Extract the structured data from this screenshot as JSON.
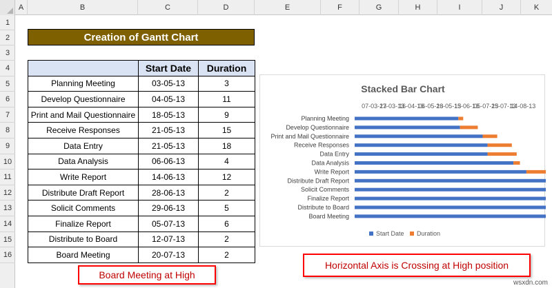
{
  "columns": [
    "A",
    "B",
    "C",
    "D",
    "E",
    "F",
    "G",
    "H",
    "I",
    "J",
    "K"
  ],
  "rows": [
    "1",
    "2",
    "3",
    "4",
    "5",
    "6",
    "7",
    "8",
    "9",
    "10",
    "11",
    "12",
    "13",
    "14",
    "15",
    "16"
  ],
  "sheet_title": "Creation of Gantt Chart",
  "table": {
    "headers": [
      "",
      "Start Date",
      "Duration"
    ],
    "tasks": [
      {
        "name": "Planning Meeting",
        "start": "03-05-13",
        "duration": "3"
      },
      {
        "name": "Develop Questionnaire",
        "start": "04-05-13",
        "duration": "11"
      },
      {
        "name": "Print and Mail Questionnaire",
        "start": "18-05-13",
        "duration": "9"
      },
      {
        "name": "Receive Responses",
        "start": "21-05-13",
        "duration": "15"
      },
      {
        "name": "Data Entry",
        "start": "21-05-13",
        "duration": "18"
      },
      {
        "name": "Data Analysis",
        "start": "06-06-13",
        "duration": "4"
      },
      {
        "name": "Write Report",
        "start": "14-06-13",
        "duration": "12"
      },
      {
        "name": "Distribute Draft Report",
        "start": "28-06-13",
        "duration": "2"
      },
      {
        "name": "Solicit Comments",
        "start": "29-06-13",
        "duration": "5"
      },
      {
        "name": "Finalize Report",
        "start": "05-07-13",
        "duration": "6"
      },
      {
        "name": "Distribute to Board",
        "start": "12-07-13",
        "duration": "2"
      },
      {
        "name": "Board Meeting",
        "start": "20-07-13",
        "duration": "2"
      }
    ]
  },
  "chart_data": {
    "type": "bar",
    "orientation": "horizontal-stacked",
    "title": "Stacked Bar Chart",
    "categories": [
      "Planning Meeting",
      "Develop Questionnaire",
      "Print and Mail Questionnaire",
      "Receive Responses",
      "Data Entry",
      "Data Analysis",
      "Write Report",
      "Distribute Draft Report",
      "Solicit Comments",
      "Finalize Report",
      "Distribute to Board",
      "Board Meeting"
    ],
    "series": [
      {
        "name": "Start Date",
        "color": "#4472c4",
        "values": [
          "2013-05-03",
          "2013-05-04",
          "2013-05-18",
          "2013-05-21",
          "2013-05-21",
          "2013-06-06",
          "2013-06-14",
          "2013-06-28",
          "2013-06-29",
          "2013-07-05",
          "2013-07-12",
          "2013-07-20"
        ]
      },
      {
        "name": "Duration",
        "color": "#ed7d31",
        "values": [
          3,
          11,
          9,
          15,
          18,
          4,
          12,
          2,
          5,
          6,
          2,
          2
        ]
      }
    ],
    "x_axis_position": "top",
    "ticks": [
      {
        "date": "2013-03-12",
        "label": "07-03-13"
      },
      {
        "date": "2013-03-23",
        "label": "27-03-13"
      },
      {
        "date": "2013-04-04",
        "label": "16-04-13"
      },
      {
        "date": "2013-04-16",
        "label": "06-05-13"
      },
      {
        "date": "2013-04-27",
        "label": "26-05-13"
      },
      {
        "date": "2013-05-08",
        "label": "15-06-13"
      },
      {
        "date": "2013-05-20",
        "label": "05-07-13"
      },
      {
        "date": "2013-05-31",
        "label": "25-07-13"
      },
      {
        "date": "2013-06-12",
        "label": "14-08-13"
      }
    ],
    "xlim": [
      "2013-02-28",
      "2013-06-20"
    ],
    "legend_placement": "bottom",
    "grid": false
  },
  "callouts": {
    "left": "Board Meeting at High",
    "right": "Horizontal Axis is Crossing at High position"
  },
  "watermark": "wsxdn.com"
}
